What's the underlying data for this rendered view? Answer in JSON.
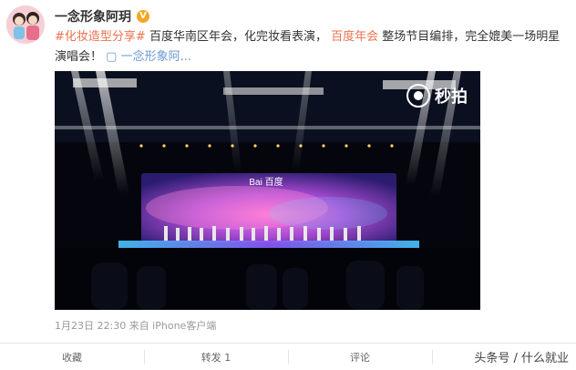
{
  "post": {
    "author": "一念形象阿玥",
    "verified_mark": "V",
    "hashtag": "#化妆造型分享#",
    "text_part1": "百度华南区年会，化完妆看表演，",
    "highlight": "百度年会",
    "text_part2": "整场节目编排，完全媲美一场明星演唱会！",
    "video_link": "一念形象阿...",
    "meta": "1月23日 22:30 来自 iPhone客户端"
  },
  "video": {
    "watermark": "秒拍",
    "stage_logo": "Bai 百度"
  },
  "actions": {
    "favorite": "收藏",
    "repost": "转发 1",
    "comment": "评论",
    "like": ""
  },
  "overlay": {
    "corner_text": "头条号 / 什么就业"
  },
  "colors": {
    "tag": "#eb7350",
    "link": "#6a98d2",
    "stage_purple": "#b04ed8",
    "stage_cyan": "#46c5ff"
  }
}
